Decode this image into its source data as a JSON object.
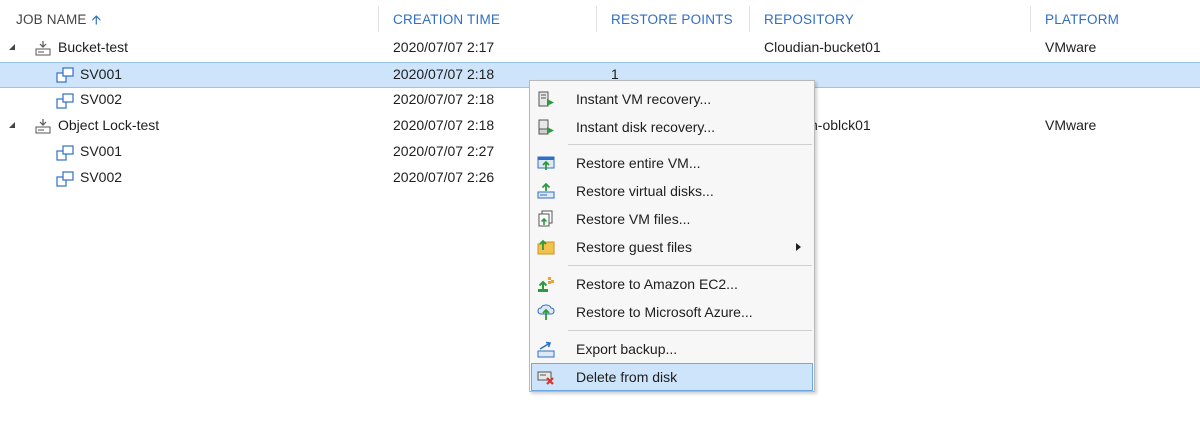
{
  "columns": [
    {
      "label": "JOB NAME",
      "sort": "ascending"
    },
    {
      "label": "CREATION TIME"
    },
    {
      "label": "RESTORE POINTS"
    },
    {
      "label": "REPOSITORY"
    },
    {
      "label": "PLATFORM"
    }
  ],
  "rows": [
    {
      "name": "Bucket-test",
      "type": "job",
      "expanded": true,
      "creation_time": "2020/07/07 2:17",
      "restore_points": "",
      "repository": "Cloudian-bucket01",
      "platform": "VMware"
    },
    {
      "name": "SV001",
      "type": "vm",
      "creation_time": "2020/07/07 2:18",
      "restore_points": "1",
      "repository": "",
      "platform": "",
      "selected": true
    },
    {
      "name": "SV002",
      "type": "vm",
      "creation_time": "2020/07/07 2:18",
      "restore_points": "",
      "repository": "",
      "platform": ""
    },
    {
      "name": "Object Lock-test",
      "type": "job",
      "expanded": true,
      "creation_time": "2020/07/07 2:18",
      "restore_points": "",
      "repository": "n-oblck01",
      "platform": "VMware"
    },
    {
      "name": "SV001",
      "type": "vm",
      "creation_time": "2020/07/07 2:27",
      "restore_points": "",
      "repository": "",
      "platform": ""
    },
    {
      "name": "SV002",
      "type": "vm",
      "creation_time": "2020/07/07 2:26",
      "restore_points": "",
      "repository": "",
      "platform": ""
    }
  ],
  "context_menu": {
    "items": [
      {
        "label": "Instant VM recovery...",
        "icon": "instant-vm-recovery-icon"
      },
      {
        "label": "Instant disk recovery...",
        "icon": "instant-disk-recovery-icon"
      },
      {
        "label": "Restore entire VM...",
        "icon": "restore-vm-icon"
      },
      {
        "label": "Restore virtual disks...",
        "icon": "restore-disks-icon"
      },
      {
        "label": "Restore VM files...",
        "icon": "restore-files-icon"
      },
      {
        "label": "Restore guest files",
        "icon": "guest-files-icon",
        "submenu": true
      },
      {
        "label": "Restore to Amazon EC2...",
        "icon": "amazon-ec2-icon"
      },
      {
        "label": "Restore to Microsoft Azure...",
        "icon": "azure-icon"
      },
      {
        "label": "Export backup...",
        "icon": "export-icon"
      },
      {
        "label": "Delete from disk",
        "icon": "delete-icon",
        "highlighted": true
      }
    ]
  },
  "colors": {
    "header_text": "#2f6fc6",
    "selection": "#cde4fa",
    "green": "#2e9a3e",
    "delete_red": "#d9342b"
  }
}
